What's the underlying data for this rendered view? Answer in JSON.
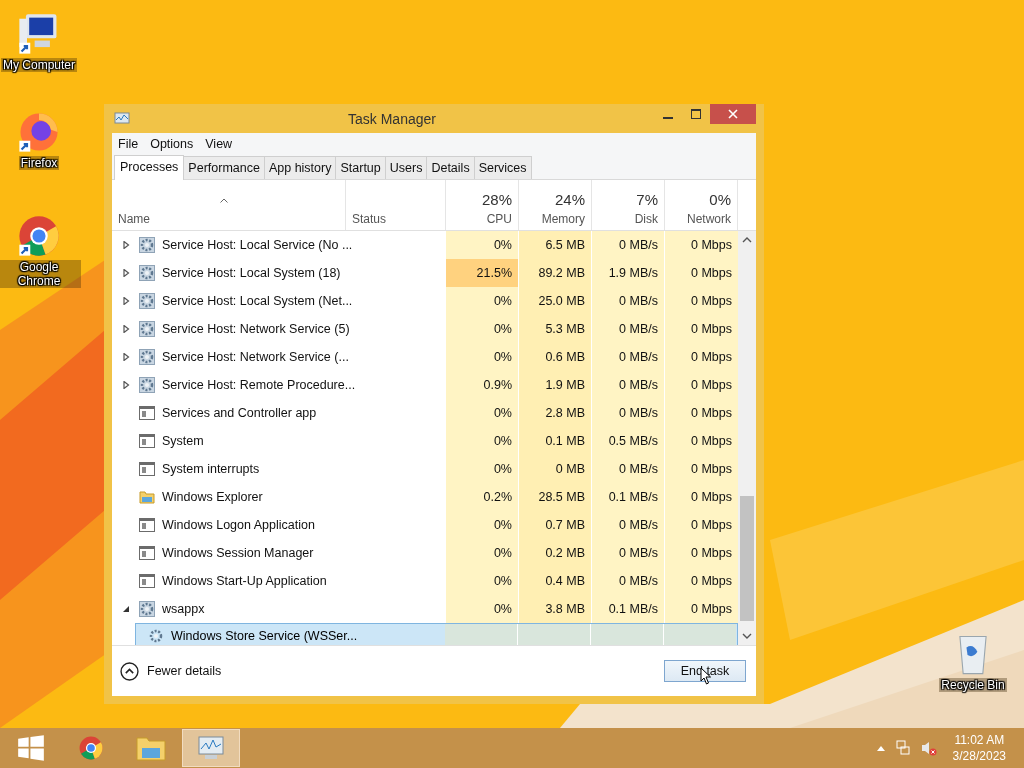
{
  "desktop_icons": [
    {
      "label": "My Computer",
      "kind": "computer"
    },
    {
      "label": "Firefox",
      "kind": "firefox"
    },
    {
      "label": "Google Chrome",
      "kind": "chrome"
    },
    {
      "label": "Recycle Bin",
      "kind": "bin"
    }
  ],
  "window": {
    "title": "Task Manager",
    "menu": [
      "File",
      "Options",
      "View"
    ],
    "tabs": [
      {
        "label": "Processes",
        "selected": true
      },
      {
        "label": "Performance",
        "selected": false
      },
      {
        "label": "App history",
        "selected": false
      },
      {
        "label": "Startup",
        "selected": false
      },
      {
        "label": "Users",
        "selected": false
      },
      {
        "label": "Details",
        "selected": false
      },
      {
        "label": "Services",
        "selected": false
      }
    ],
    "columns": [
      {
        "label": "Name"
      },
      {
        "label": "Status"
      },
      {
        "total": "28%",
        "label": "CPU"
      },
      {
        "total": "24%",
        "label": "Memory"
      },
      {
        "total": "7%",
        "label": "Disk"
      },
      {
        "total": "0%",
        "label": "Network"
      }
    ],
    "rows": [
      {
        "name": "Service Host: Local Service (No ...",
        "kind": "service_group",
        "expanded": false,
        "selected": false,
        "cpu_high": false,
        "cpu": "0%",
        "memory": "6.5 MB",
        "disk": "0 MB/s",
        "network": "0 Mbps"
      },
      {
        "name": "Service Host: Local System (18)",
        "kind": "service_group",
        "expanded": false,
        "selected": false,
        "cpu_high": true,
        "cpu": "21.5%",
        "memory": "89.2 MB",
        "disk": "1.9 MB/s",
        "network": "0 Mbps"
      },
      {
        "name": "Service Host: Local System (Net...",
        "kind": "service_group",
        "expanded": false,
        "selected": false,
        "cpu_high": false,
        "cpu": "0%",
        "memory": "25.0 MB",
        "disk": "0 MB/s",
        "network": "0 Mbps"
      },
      {
        "name": "Service Host: Network Service (5)",
        "kind": "service_group",
        "expanded": false,
        "selected": false,
        "cpu_high": false,
        "cpu": "0%",
        "memory": "5.3 MB",
        "disk": "0 MB/s",
        "network": "0 Mbps"
      },
      {
        "name": "Service Host: Network Service (...",
        "kind": "service_group",
        "expanded": false,
        "selected": false,
        "cpu_high": false,
        "cpu": "0%",
        "memory": "0.6 MB",
        "disk": "0 MB/s",
        "network": "0 Mbps"
      },
      {
        "name": "Service Host: Remote Procedure...",
        "kind": "service_group",
        "expanded": false,
        "selected": false,
        "cpu_high": false,
        "cpu": "0.9%",
        "memory": "1.9 MB",
        "disk": "0 MB/s",
        "network": "0 Mbps"
      },
      {
        "name": "Services and Controller app",
        "kind": "app",
        "selected": false,
        "cpu_high": false,
        "cpu": "0%",
        "memory": "2.8 MB",
        "disk": "0 MB/s",
        "network": "0 Mbps"
      },
      {
        "name": "System",
        "kind": "app",
        "selected": false,
        "cpu_high": false,
        "cpu": "0%",
        "memory": "0.1 MB",
        "disk": "0.5 MB/s",
        "network": "0 Mbps"
      },
      {
        "name": "System interrupts",
        "kind": "app",
        "selected": false,
        "cpu_high": false,
        "cpu": "0%",
        "memory": "0 MB",
        "disk": "0 MB/s",
        "network": "0 Mbps"
      },
      {
        "name": "Windows Explorer",
        "kind": "folder",
        "selected": false,
        "cpu_high": false,
        "cpu": "0.2%",
        "memory": "28.5 MB",
        "disk": "0.1 MB/s",
        "network": "0 Mbps"
      },
      {
        "name": "Windows Logon Application",
        "kind": "app",
        "selected": false,
        "cpu_high": false,
        "cpu": "0%",
        "memory": "0.7 MB",
        "disk": "0 MB/s",
        "network": "0 Mbps"
      },
      {
        "name": "Windows Session Manager",
        "kind": "app",
        "selected": false,
        "cpu_high": false,
        "cpu": "0%",
        "memory": "0.2 MB",
        "disk": "0 MB/s",
        "network": "0 Mbps"
      },
      {
        "name": "Windows Start-Up Application",
        "kind": "app",
        "selected": false,
        "cpu_high": false,
        "cpu": "0%",
        "memory": "0.4 MB",
        "disk": "0 MB/s",
        "network": "0 Mbps"
      },
      {
        "name": "wsappx",
        "kind": "service_group",
        "expanded": true,
        "selected": false,
        "cpu_high": false,
        "cpu": "0%",
        "memory": "3.8 MB",
        "disk": "0.1 MB/s",
        "network": "0 Mbps",
        "children": [
          {
            "name": "Windows Store Service (WSSer...",
            "kind": "service",
            "selected": true
          }
        ]
      }
    ],
    "fewer_details": "Fewer details",
    "end_task": "End task"
  },
  "taskbar": {
    "apps": [
      {
        "kind": "start",
        "active": false
      },
      {
        "kind": "chrome",
        "active": false
      },
      {
        "kind": "explorer",
        "active": false
      },
      {
        "kind": "taskmgr",
        "active": true
      }
    ],
    "time": "11:02 AM",
    "date": "3/28/2023"
  }
}
